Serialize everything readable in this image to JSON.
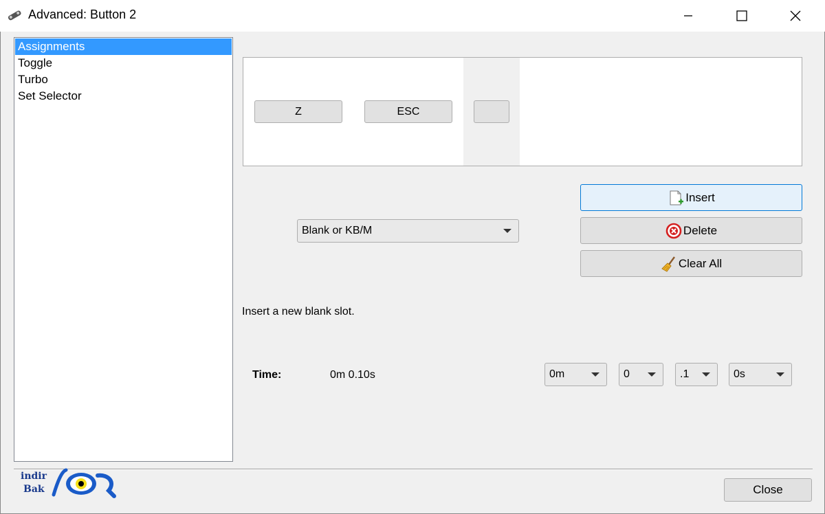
{
  "window": {
    "title": "Advanced: Button 2",
    "minimize_icon": "minimize-icon",
    "maximize_icon": "maximize-icon",
    "close_icon": "close-icon"
  },
  "sidebar": {
    "items": [
      {
        "label": "Assignments",
        "selected": true
      },
      {
        "label": "Toggle",
        "selected": false
      },
      {
        "label": "Turbo",
        "selected": false
      },
      {
        "label": "Set Selector",
        "selected": false
      }
    ]
  },
  "slots": [
    {
      "label": "Z"
    },
    {
      "label": "ESC"
    },
    {
      "label": ""
    }
  ],
  "slot_type_combo": {
    "value": "Blank or KB/M"
  },
  "actions": {
    "insert_label": "Insert",
    "delete_label": "Delete",
    "clear_all_label": "Clear All"
  },
  "hint": "Insert a new blank slot.",
  "time": {
    "label": "Time:",
    "value": "0m 0.10s",
    "minutes": "0m",
    "seconds": "0",
    "fraction": ".1",
    "extra": "0s"
  },
  "close_button": {
    "label": "Close"
  },
  "watermark": {
    "line1": "indir",
    "line2": "Bak",
    "logo": "iOQ"
  },
  "colors": {
    "selection": "#3399ff",
    "accent": "#0078d7"
  }
}
